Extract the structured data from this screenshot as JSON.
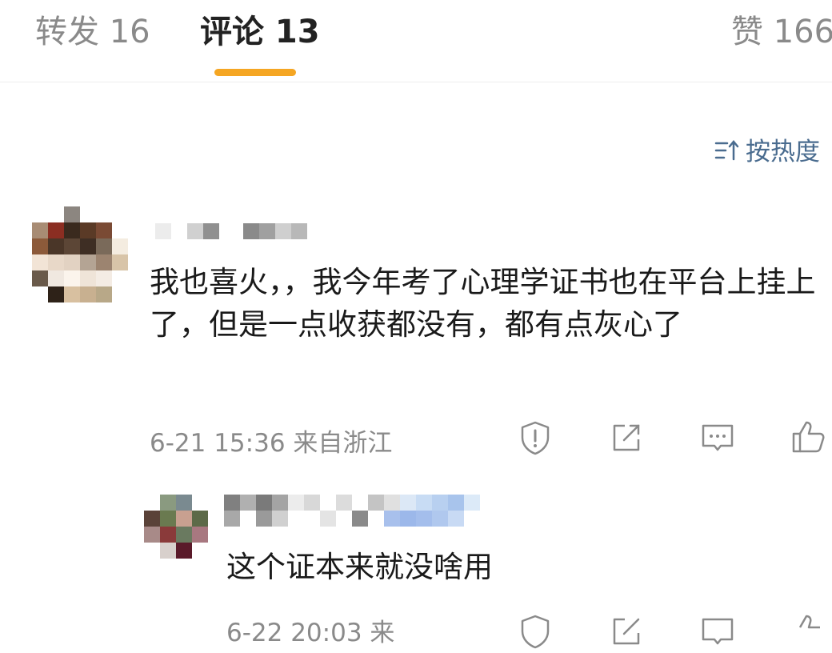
{
  "tabs": {
    "repost": "转发 16",
    "comments": "评论 13",
    "likes": "赞 166"
  },
  "sort": {
    "label": "按热度",
    "icon": "sort-icon"
  },
  "comments": [
    {
      "text": "我也喜火，，我今年考了心理学证书也在平台上挂上了，但是一点收获都没有，都有点灰心了",
      "meta": "6-21 15:36  来自浙江",
      "actions": [
        "report-icon",
        "share-icon",
        "comment-icon",
        "like-icon"
      ]
    },
    {
      "text": "这个证本来就没啥用",
      "meta": "6-22 20:03  来"
    }
  ],
  "colors": {
    "accent": "#f5a623",
    "link": "#4a6c8f",
    "muted": "#8a8a8a"
  }
}
